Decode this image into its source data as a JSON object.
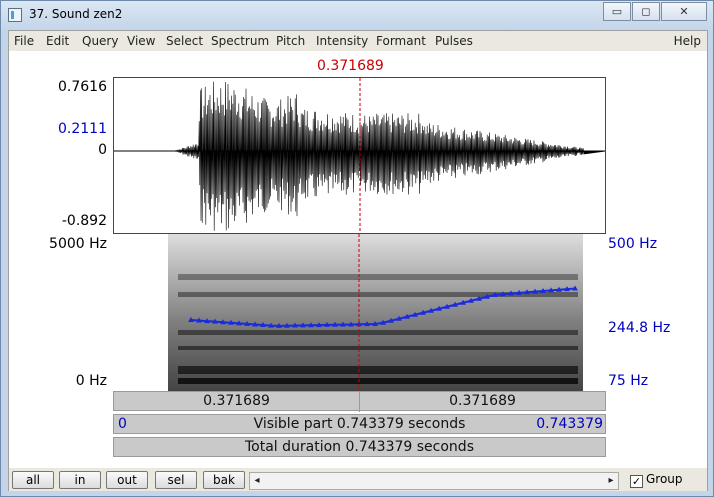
{
  "window": {
    "title": "37. Sound zen2",
    "buttons": {
      "minimize": "▭",
      "maximize": "◻",
      "close": "✕"
    }
  },
  "menu": [
    "File",
    "Edit",
    "Query",
    "View",
    "Select",
    "Spectrum",
    "Pitch",
    "Intensity",
    "Formant",
    "Pulses"
  ],
  "help": "Help",
  "cursor": {
    "time": "0.371689",
    "fraction": 0.5
  },
  "waveform": {
    "y_top": "0.7616",
    "y_cursor": "0.2111",
    "y_zero": "0",
    "y_bottom": "-0.892"
  },
  "spectrogram": {
    "freq_top": "5000 Hz",
    "freq_bottom": "0 Hz",
    "pitch_top": "500 Hz",
    "pitch_cursor": "244.8 Hz",
    "pitch_bottom": "75 Hz"
  },
  "info": {
    "left_time": "0.371689",
    "right_time": "0.371689",
    "visible_start": "0",
    "visible_text": "Visible part 0.743379 seconds",
    "visible_end": "0.743379",
    "total": "Total duration 0.743379 seconds"
  },
  "buttons": [
    "all",
    "in",
    "out",
    "sel",
    "bak"
  ],
  "group_label": "Group",
  "group_checked": "✓",
  "scroll_left": "◂",
  "scroll_right": "▸",
  "colors": {
    "cursor": "#cc0000",
    "pitch": "#0000c0"
  }
}
